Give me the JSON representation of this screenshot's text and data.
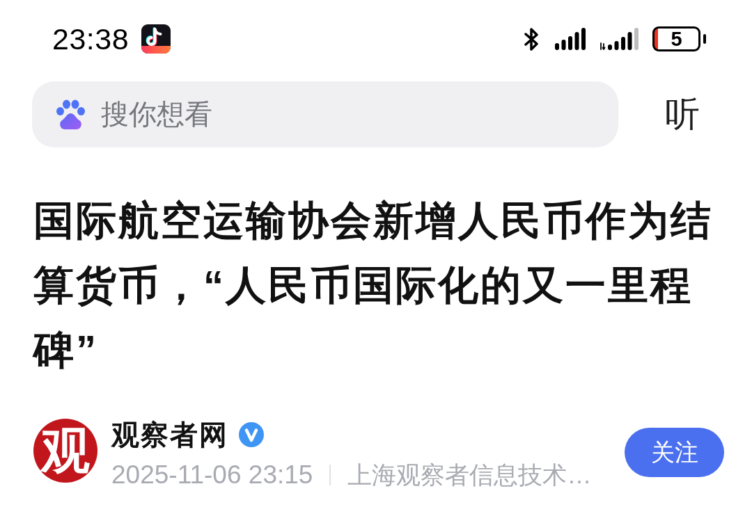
{
  "status_bar": {
    "time": "23:38",
    "battery": "5"
  },
  "search": {
    "placeholder": "搜你想看",
    "listen_button": "听"
  },
  "article": {
    "title": "国际航空运输协会新增人民币作为结算货币，“人民币国际化的又一里程碑”"
  },
  "author": {
    "logo_text": "观",
    "name": "观察者网",
    "verified": true,
    "date": "2025-11-06 23:15",
    "source": "上海观察者信息技术…",
    "follow_button": "关注"
  }
}
